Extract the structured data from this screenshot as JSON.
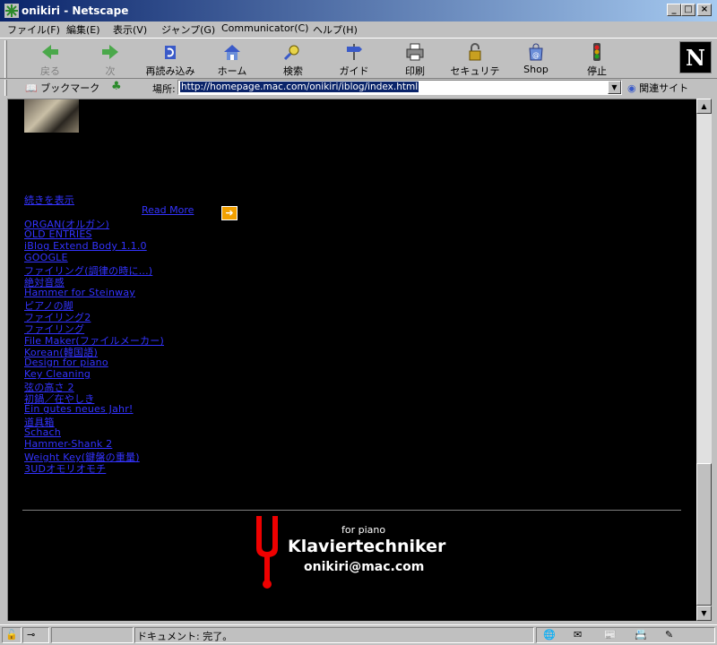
{
  "window": {
    "title": "onikiri - Netscape"
  },
  "menus": [
    "ファイル(F)",
    "編集(E)",
    "表示(V)",
    "ジャンプ(G)",
    "Communicator(C)",
    "ヘルプ(H)"
  ],
  "toolbar": [
    {
      "label": "戻る",
      "icon": "back-arrow-icon"
    },
    {
      "label": "次",
      "icon": "forward-arrow-icon"
    },
    {
      "label": "再読み込み",
      "icon": "reload-icon"
    },
    {
      "label": "ホーム",
      "icon": "home-icon"
    },
    {
      "label": "検索",
      "icon": "search-icon"
    },
    {
      "label": "ガイド",
      "icon": "guide-icon"
    },
    {
      "label": "印刷",
      "icon": "print-icon"
    },
    {
      "label": "セキュリティ",
      "icon": "security-lock-icon"
    },
    {
      "label": "Shop",
      "icon": "shop-icon"
    },
    {
      "label": "停止",
      "icon": "stop-icon"
    }
  ],
  "brand": "N",
  "location": {
    "bookmarks_label": "ブックマーク",
    "label": "場所:",
    "url": "http://homepage.mac.com/onikiri/iblog/index.html",
    "related_label": "関連サイト"
  },
  "content": {
    "continue_link": "続きを表示",
    "read_more": "Read More",
    "links": [
      "ORGAN(オルガン)",
      "OLD ENTRIES",
      "iBlog Extend Body 1.1.0",
      "GOOGLE",
      "ファイリング(調律の時に...)",
      "絶対音感",
      "Hammer for Steinway",
      "ピアノの脚",
      "ファイリング2",
      "ファイリング",
      "File Maker(ファイルメーカー)",
      "Korean(韓国語)",
      "Design for piano",
      "Key Cleaning",
      "弦の高さ 2",
      "初鍋／在やしき",
      "Ein gutes neues Jahr!",
      "道具箱",
      "Schach",
      "Hammer-Shank 2",
      "Weight Key(鍵盤の重量)",
      "3UDオモリオモチ"
    ],
    "logo": {
      "small": "for piano",
      "title": "Klaviertechniker",
      "email": "onikiri@mac.com"
    }
  },
  "status": {
    "text": "ドキュメント: 完了。"
  },
  "colors": {
    "link": "#3333ff",
    "page_bg": "#000000",
    "fork": "#ee0000",
    "arrow_button": "#f2a000"
  }
}
